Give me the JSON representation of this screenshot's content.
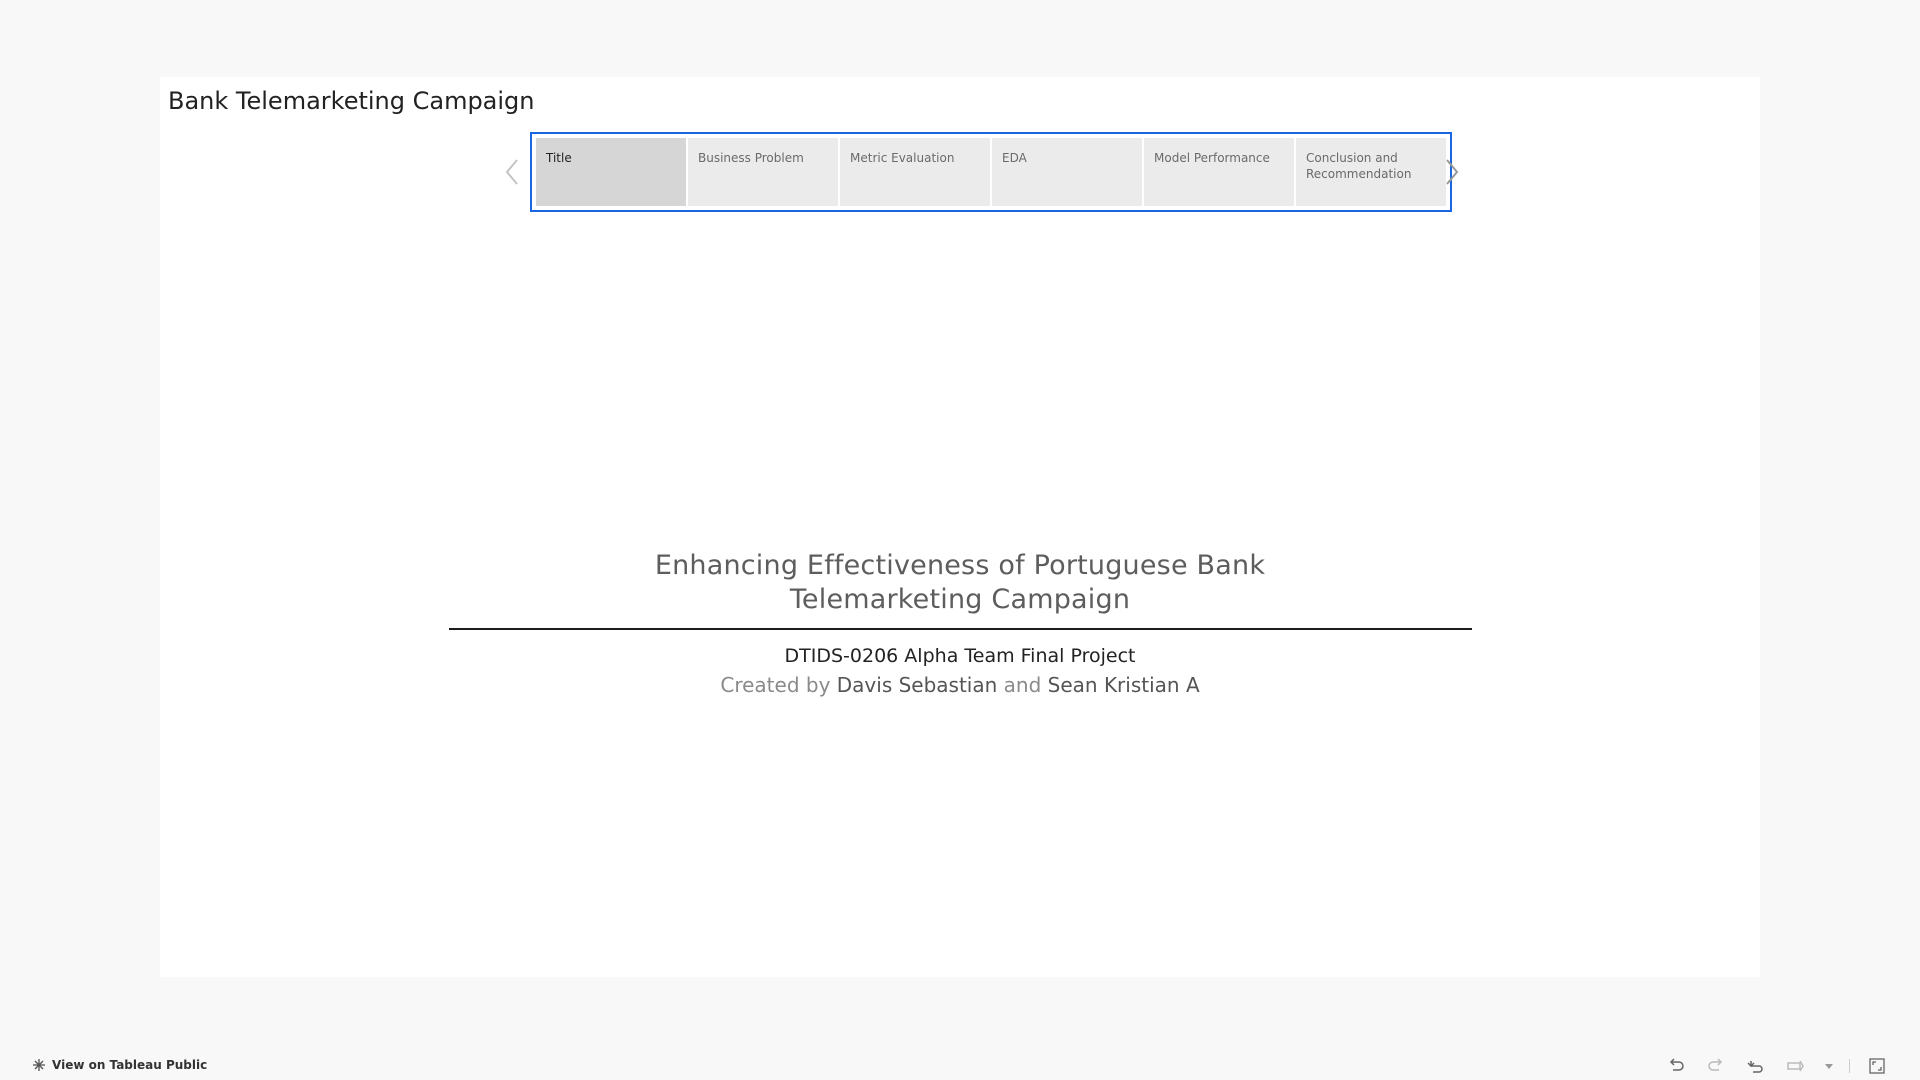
{
  "story": {
    "title": "Bank Telemarketing Campaign"
  },
  "navigator": {
    "items": [
      {
        "label": "Title",
        "active": true
      },
      {
        "label": "Business Problem",
        "active": false
      },
      {
        "label": "Metric Evaluation",
        "active": false
      },
      {
        "label": "EDA",
        "active": false
      },
      {
        "label": "Model Performance",
        "active": false
      },
      {
        "label": "Conclusion and Recommendation",
        "active": false
      }
    ],
    "prev_icon": "chevron-left-icon",
    "next_icon": "chevron-right-icon",
    "highlight_color": "#1a66e0"
  },
  "content": {
    "main_title": "Enhancing Effectiveness of Portuguese Bank Telemarketing Campaign",
    "subtitle": "DTIDS-0206 Alpha Team Final Project",
    "credits": {
      "prefix": "Created by",
      "author1": "Davis Sebastian",
      "joiner": "and",
      "author2": "Sean Kristian A"
    }
  },
  "footer": {
    "view_link": "View on Tableau Public",
    "icons": [
      "undo-icon",
      "redo-icon",
      "revert-icon",
      "share-icon",
      "dropdown-icon",
      "fullscreen-icon"
    ]
  }
}
